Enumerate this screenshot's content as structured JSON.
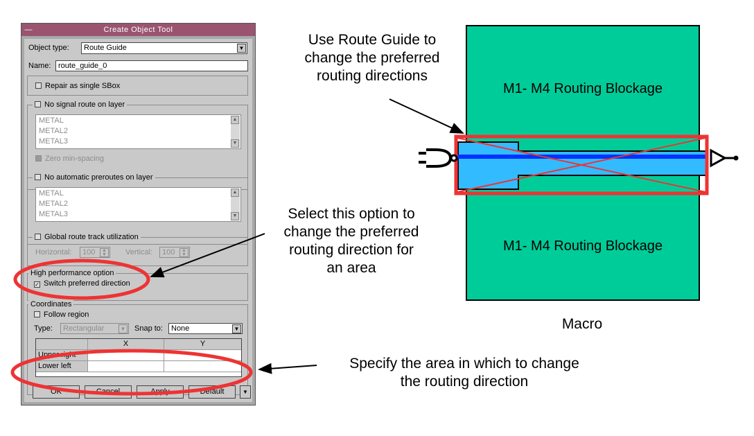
{
  "dialog": {
    "title": "Create Object Tool",
    "object_type_label": "Object type:",
    "object_type_value": "Route Guide",
    "name_label": "Name:",
    "name_value": "route_guide_0",
    "repair_label": "Repair as single SBox",
    "no_signal_label": "No signal route on layer",
    "no_signal_layers": [
      "METAL",
      "METAL2",
      "METAL3"
    ],
    "zero_min_spacing": "Zero min-spacing",
    "no_auto_label": "No automatic preroutes on layer",
    "no_auto_layers": [
      "METAL",
      "METAL2",
      "METAL3"
    ],
    "global_route_label": "Global route track utilization",
    "horizontal_label": "Horizontal:",
    "horizontal_value": "100",
    "vertical_label": "Vertical:",
    "vertical_value": "100",
    "high_perf_label": "High performance option",
    "switch_pref_label": "Switch preferred direction",
    "switch_pref_checked": true,
    "coordinates_label": "Coordinates",
    "follow_region_label": "Follow region",
    "type_label": "Type:",
    "type_value": "Rectangular",
    "snap_label": "Snap to:",
    "snap_value": "None",
    "table_headers": [
      "X",
      "Y"
    ],
    "table_rows": [
      "Upper right",
      "Lower left"
    ],
    "buttons": {
      "ok": "OK",
      "cancel": "Cancel",
      "apply": "Apply",
      "default": "Default"
    }
  },
  "annotations": {
    "route_guide_note": [
      "Use Route Guide to",
      "change the preferred",
      "routing directions"
    ],
    "select_option_note": [
      "Select this option to",
      "change the preferred",
      "routing direction for",
      "an area"
    ],
    "specify_area_note": [
      "Specify the area in which to change",
      "the routing direction"
    ]
  },
  "macro": {
    "label": "Macro",
    "blockage_top": "M1- M4 Routing Blockage",
    "blockage_bottom": "M1- M4 Routing Blockage",
    "fill_color": "#00cc99",
    "route_color": "#0033ff",
    "area_color": "#33bbff",
    "guide_color": "#ee3333"
  }
}
